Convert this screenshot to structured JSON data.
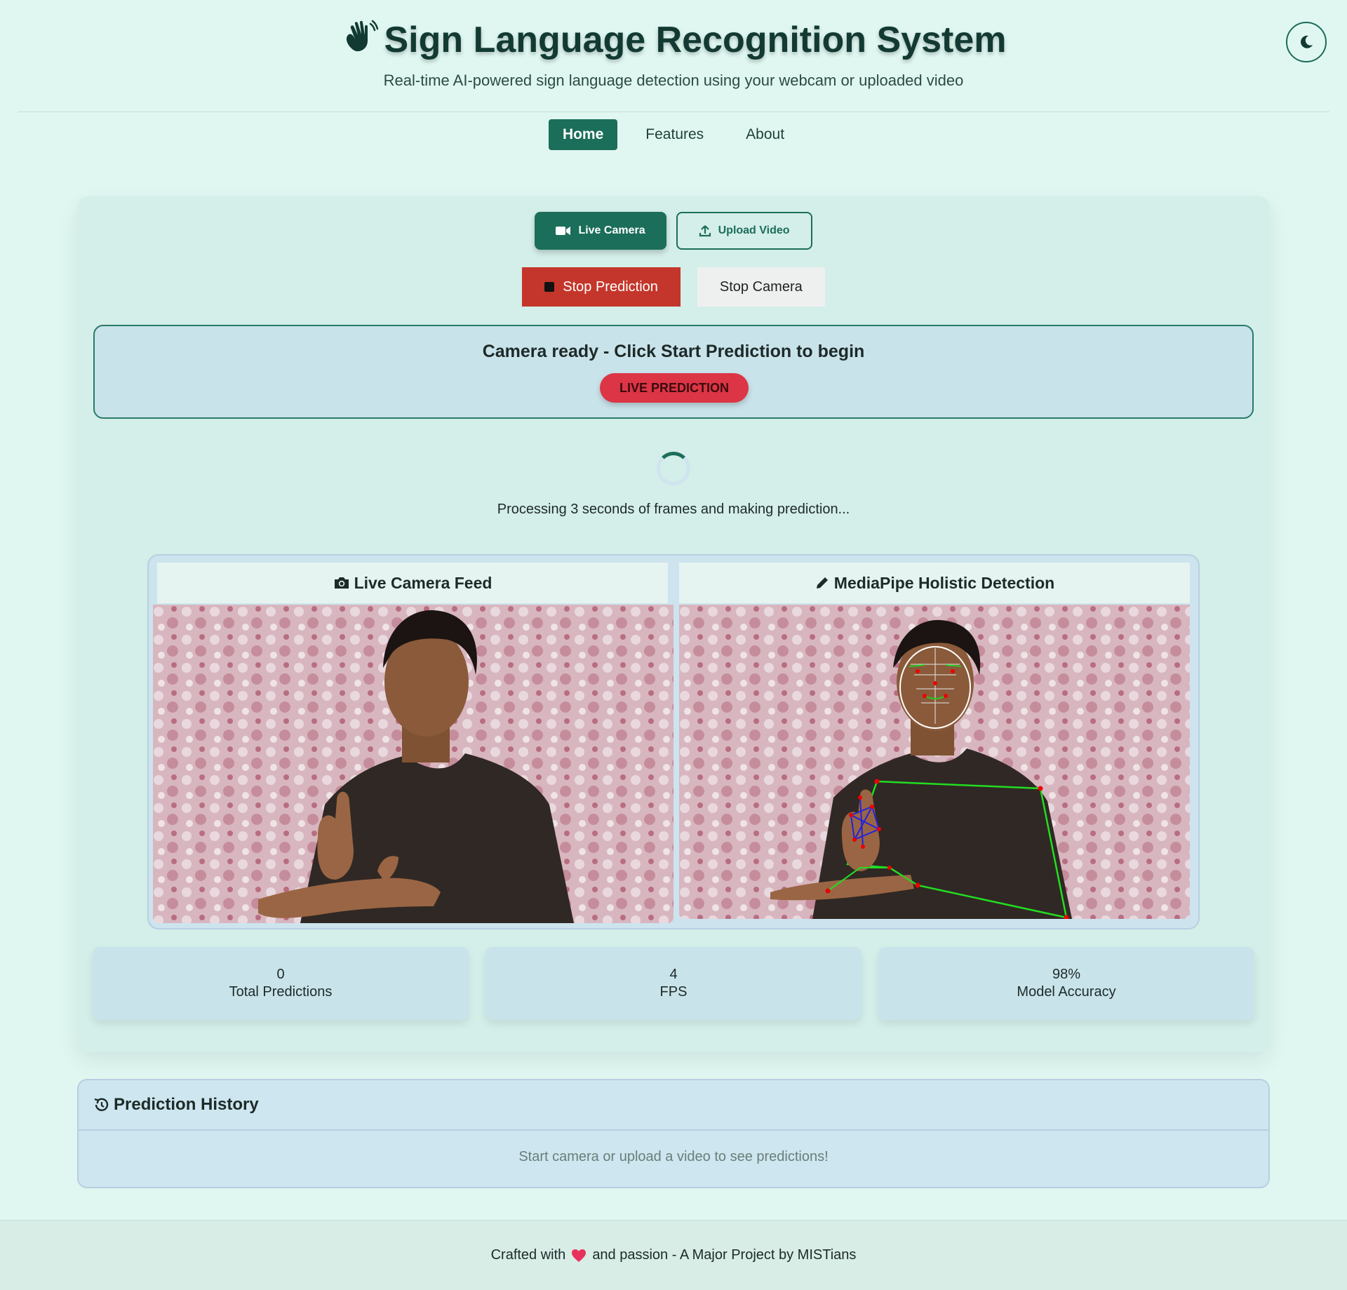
{
  "header": {
    "title": "Sign Language Recognition System",
    "subtitle": "Real-time AI-powered sign language detection using your webcam or uploaded video",
    "title_icon": "waving-hand-icon",
    "theme_toggle_icon": "moon-icon"
  },
  "nav": {
    "home": "Home",
    "features": "Features",
    "about": "About"
  },
  "mode": {
    "live_camera": "Live Camera",
    "upload_video": "Upload Video"
  },
  "controls": {
    "stop_prediction": "Stop Prediction",
    "stop_camera": "Stop Camera"
  },
  "status": {
    "message": "Camera ready - Click Start Prediction to begin",
    "badge": "LIVE PREDICTION"
  },
  "processing": "Processing 3 seconds of frames and making prediction...",
  "panels": {
    "live_feed": "Live Camera Feed",
    "detection": "MediaPipe Holistic Detection"
  },
  "stats": [
    {
      "value": "0",
      "label": "Total Predictions"
    },
    {
      "value": "4",
      "label": "FPS"
    },
    {
      "value": "98%",
      "label": "Model Accuracy"
    }
  ],
  "history": {
    "title": "Prediction History",
    "empty": "Start camera or upload a video to see predictions!"
  },
  "footer": {
    "before": "Crafted with",
    "after": "and passion - A Major Project by MISTians"
  },
  "colors": {
    "primary": "#1b6e5a",
    "danger": "#dc3545",
    "stop": "#c4362b",
    "background": "#e0f7f1"
  }
}
